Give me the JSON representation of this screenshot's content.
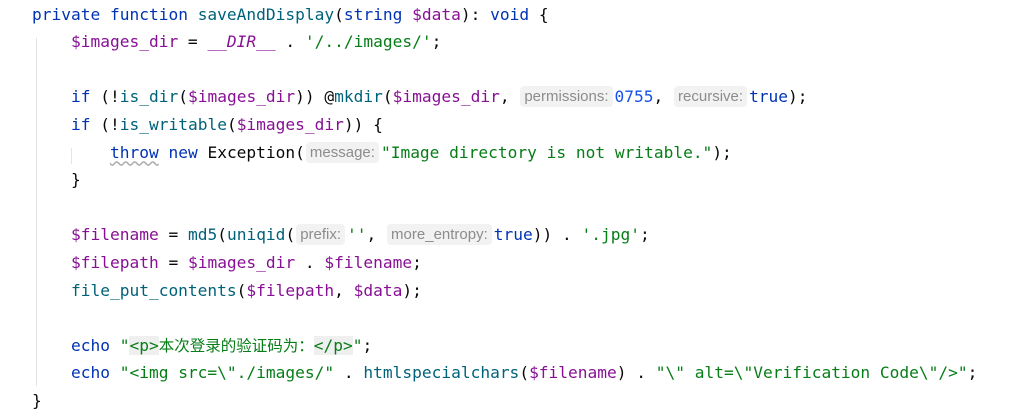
{
  "editor": {
    "lines": [
      [
        {
          "t": "private ",
          "c": "kw"
        },
        {
          "t": "function ",
          "c": "kw"
        },
        {
          "t": "saveAndDisplay",
          "c": "fn"
        },
        {
          "t": "(",
          "c": "plain"
        },
        {
          "t": "string ",
          "c": "kw"
        },
        {
          "t": "$data",
          "c": "var"
        },
        {
          "t": "): ",
          "c": "plain"
        },
        {
          "t": "void",
          "c": "kw"
        },
        {
          "t": " {",
          "c": "plain"
        }
      ],
      [
        {
          "t": "    ",
          "c": "plain"
        },
        {
          "t": "$images_dir",
          "c": "var"
        },
        {
          "t": " = ",
          "c": "plain"
        },
        {
          "t": "__DIR__",
          "c": "const"
        },
        {
          "t": " . ",
          "c": "plain"
        },
        {
          "t": "'/../images/'",
          "c": "str"
        },
        {
          "t": ";",
          "c": "plain"
        }
      ],
      [],
      [
        {
          "t": "    ",
          "c": "plain"
        },
        {
          "t": "if",
          "c": "kw"
        },
        {
          "t": " (!",
          "c": "plain"
        },
        {
          "t": "is_dir",
          "c": "fn"
        },
        {
          "t": "(",
          "c": "plain"
        },
        {
          "t": "$images_dir",
          "c": "var"
        },
        {
          "t": ")) @",
          "c": "plain"
        },
        {
          "t": "mkdir",
          "c": "fn"
        },
        {
          "t": "(",
          "c": "plain"
        },
        {
          "t": "$images_dir",
          "c": "var"
        },
        {
          "t": ", ",
          "c": "plain"
        },
        {
          "t": "permissions:",
          "c": "hint"
        },
        {
          "t": "0755",
          "c": "num"
        },
        {
          "t": ", ",
          "c": "plain"
        },
        {
          "t": "recursive:",
          "c": "hint"
        },
        {
          "t": "true",
          "c": "kw"
        },
        {
          "t": ");",
          "c": "plain"
        }
      ],
      [
        {
          "t": "    ",
          "c": "plain"
        },
        {
          "t": "if",
          "c": "kw"
        },
        {
          "t": " (!",
          "c": "plain"
        },
        {
          "t": "is_writable",
          "c": "fn"
        },
        {
          "t": "(",
          "c": "plain"
        },
        {
          "t": "$images_dir",
          "c": "var"
        },
        {
          "t": ")) {",
          "c": "plain"
        }
      ],
      [
        {
          "t": "        ",
          "c": "plain"
        },
        {
          "t": "throw",
          "c": "kw squiggle"
        },
        {
          "t": " ",
          "c": "plain"
        },
        {
          "t": "new",
          "c": "kw"
        },
        {
          "t": " Exception(",
          "c": "plain"
        },
        {
          "t": "message:",
          "c": "hint"
        },
        {
          "t": "\"Image directory is not writable.\"",
          "c": "str"
        },
        {
          "t": ");",
          "c": "plain"
        }
      ],
      [
        {
          "t": "    }",
          "c": "plain"
        }
      ],
      [],
      [
        {
          "t": "    ",
          "c": "plain"
        },
        {
          "t": "$filename",
          "c": "var"
        },
        {
          "t": " = ",
          "c": "plain"
        },
        {
          "t": "md5",
          "c": "fn"
        },
        {
          "t": "(",
          "c": "plain"
        },
        {
          "t": "uniqid",
          "c": "fn"
        },
        {
          "t": "(",
          "c": "plain"
        },
        {
          "t": "prefix:",
          "c": "hint"
        },
        {
          "t": "''",
          "c": "str"
        },
        {
          "t": ", ",
          "c": "plain"
        },
        {
          "t": "more_entropy:",
          "c": "hint"
        },
        {
          "t": "true",
          "c": "kw"
        },
        {
          "t": ")) . ",
          "c": "plain"
        },
        {
          "t": "'.jpg'",
          "c": "str"
        },
        {
          "t": ";",
          "c": "plain"
        }
      ],
      [
        {
          "t": "    ",
          "c": "plain"
        },
        {
          "t": "$filepath",
          "c": "var"
        },
        {
          "t": " = ",
          "c": "plain"
        },
        {
          "t": "$images_dir",
          "c": "var"
        },
        {
          "t": " . ",
          "c": "plain"
        },
        {
          "t": "$filename",
          "c": "var"
        },
        {
          "t": ";",
          "c": "plain"
        }
      ],
      [
        {
          "t": "    ",
          "c": "plain"
        },
        {
          "t": "file_put_contents",
          "c": "fn"
        },
        {
          "t": "(",
          "c": "plain"
        },
        {
          "t": "$filepath",
          "c": "var"
        },
        {
          "t": ", ",
          "c": "plain"
        },
        {
          "t": "$data",
          "c": "var"
        },
        {
          "t": ");",
          "c": "plain"
        }
      ],
      [],
      [
        {
          "t": "    ",
          "c": "plain"
        },
        {
          "t": "echo",
          "c": "kw"
        },
        {
          "t": " \"",
          "c": "str"
        },
        {
          "t": "<p>",
          "c": "str html-tag"
        },
        {
          "t": "本次登录的验证码为：",
          "c": "str cjk"
        },
        {
          "t": "</p>",
          "c": "str html-tag"
        },
        {
          "t": "\"",
          "c": "str"
        },
        {
          "t": ";",
          "c": "plain"
        }
      ],
      [
        {
          "t": "    ",
          "c": "plain"
        },
        {
          "t": "echo",
          "c": "kw"
        },
        {
          "t": " \"<img src=\\\"./images/\"",
          "c": "str"
        },
        {
          "t": " . ",
          "c": "plain"
        },
        {
          "t": "htmlspecialchars",
          "c": "fn"
        },
        {
          "t": "(",
          "c": "plain"
        },
        {
          "t": "$filename",
          "c": "var"
        },
        {
          "t": ") . ",
          "c": "plain"
        },
        {
          "t": "\"\\\" alt=\\\"Verification Code\\\"/>\"",
          "c": "str"
        },
        {
          "t": ";",
          "c": "plain"
        }
      ],
      [
        {
          "t": "}",
          "c": "plain"
        }
      ]
    ]
  }
}
